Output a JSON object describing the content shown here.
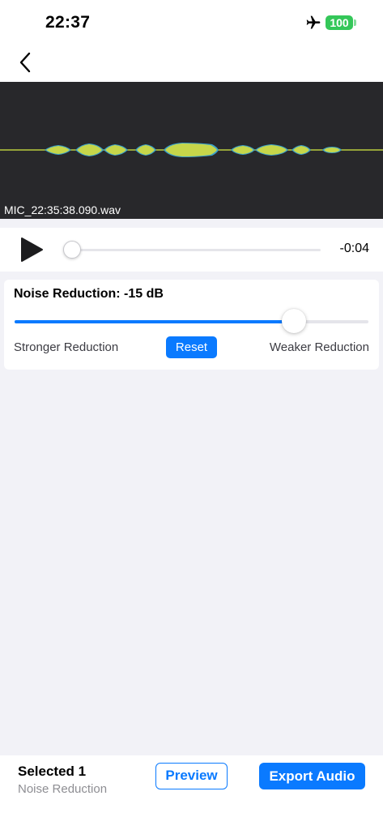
{
  "status_bar": {
    "time": "22:37",
    "battery": "100",
    "airplane_icon": "airplane-icon"
  },
  "nav": {
    "back_icon": "chevron-left-icon"
  },
  "waveform": {
    "file_name": "MIC_22:35:38.090.wav",
    "colors": {
      "background": "#28282b",
      "wave": "#c6d64a",
      "edge": "#3aa0c8"
    }
  },
  "player": {
    "play_icon": "play-icon",
    "progress": 0.0,
    "remaining": "-0:04"
  },
  "noise_reduction": {
    "title": "Noise Reduction: -15 dB",
    "level": 0.79,
    "left_label": "Stronger Reduction",
    "right_label": "Weaker Reduction",
    "reset_label": "Reset"
  },
  "bottom": {
    "selected_count": "Selected 1",
    "selected_effect": "Noise Reduction",
    "preview_label": "Preview",
    "export_label": "Export Audio"
  },
  "colors": {
    "accent": "#0a7aff",
    "battery": "#34c759"
  }
}
